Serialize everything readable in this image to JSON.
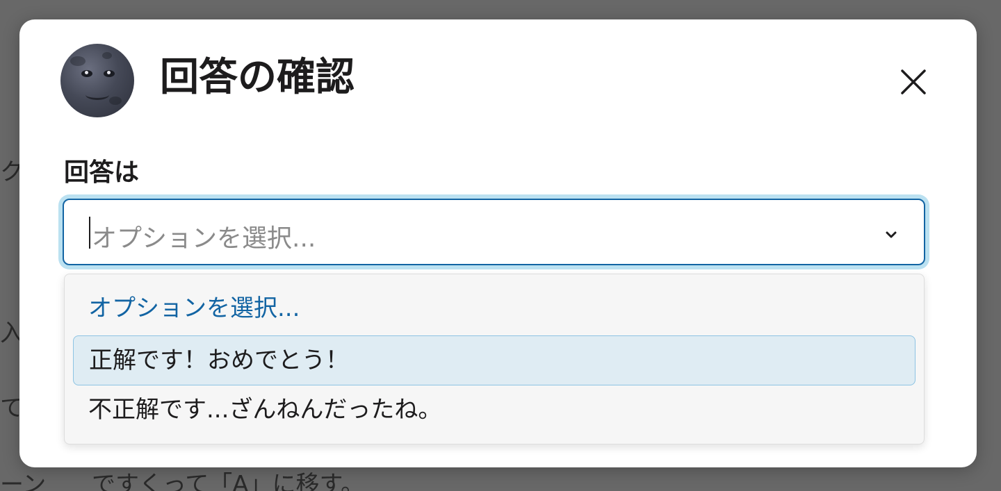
{
  "background": {
    "text_lines": [
      "ク",
      "入",
      "て",
      "ーン",
      "ですくって「A」に移す。"
    ]
  },
  "modal": {
    "title": "回答の確認",
    "avatar_icon": "full-moon-face-icon",
    "close_icon": "close-icon",
    "field_label": "回答は",
    "select": {
      "placeholder": "オプションを選択...",
      "chevron_icon": "chevron-down-icon"
    },
    "dropdown": {
      "options": [
        {
          "label": "オプションを選択..."
        },
        {
          "label": "正解です！おめでとう！"
        },
        {
          "label": "不正解です...ざんねんだったね。"
        }
      ]
    }
  },
  "colors": {
    "accent": "#1264a3",
    "focus_ring": "#1d9bd1",
    "highlight": "#dfecf3",
    "primary_button": "#0b6b4a"
  }
}
